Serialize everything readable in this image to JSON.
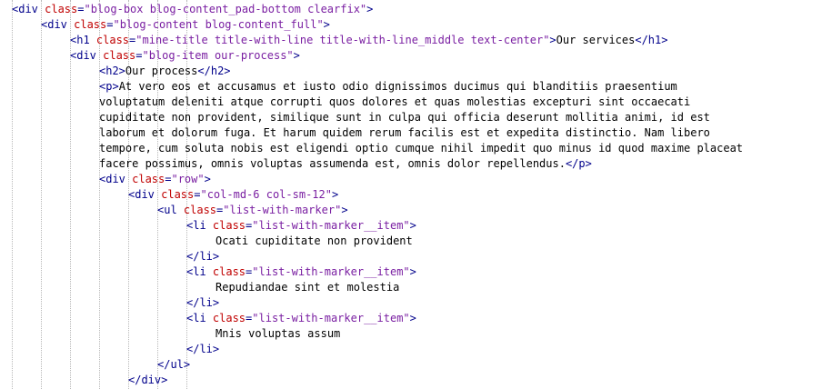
{
  "colors": {
    "background": "#ffffff",
    "tag": "#00008b",
    "attribute": "#c00000",
    "value": "#7a1fa2",
    "text": "#000000",
    "indent_guide": "#b8b8b8"
  },
  "lines": [
    {
      "indent": 0,
      "tokens": [
        {
          "t": "tag",
          "v": "<div "
        },
        {
          "t": "attr",
          "v": "class"
        },
        {
          "t": "tag",
          "v": "="
        },
        {
          "t": "val",
          "v": "\"blog-box blog-content_pad-bottom clearfix\""
        },
        {
          "t": "tag",
          "v": ">"
        }
      ]
    },
    {
      "indent": 1,
      "tokens": [
        {
          "t": "tag",
          "v": "<div "
        },
        {
          "t": "attr",
          "v": "class"
        },
        {
          "t": "tag",
          "v": "="
        },
        {
          "t": "val",
          "v": "\"blog-content blog-content_full\""
        },
        {
          "t": "tag",
          "v": ">"
        }
      ]
    },
    {
      "indent": 2,
      "tokens": [
        {
          "t": "tag",
          "v": "<h1 "
        },
        {
          "t": "attr",
          "v": "class"
        },
        {
          "t": "tag",
          "v": "="
        },
        {
          "t": "val",
          "v": "\"mine-title title-with-line title-with-line_middle text-center\""
        },
        {
          "t": "tag",
          "v": ">"
        },
        {
          "t": "txt",
          "v": "Our services"
        },
        {
          "t": "tag",
          "v": "</h1>"
        }
      ]
    },
    {
      "indent": 2,
      "tokens": [
        {
          "t": "tag",
          "v": "<div "
        },
        {
          "t": "attr",
          "v": "class"
        },
        {
          "t": "tag",
          "v": "="
        },
        {
          "t": "val",
          "v": "\"blog-item our-process\""
        },
        {
          "t": "tag",
          "v": ">"
        }
      ]
    },
    {
      "indent": 3,
      "tokens": [
        {
          "t": "tag",
          "v": "<h2>"
        },
        {
          "t": "txt",
          "v": "Our process"
        },
        {
          "t": "tag",
          "v": "</h2>"
        }
      ]
    },
    {
      "indent": 3,
      "tokens": [
        {
          "t": "tag",
          "v": "<p>"
        },
        {
          "t": "txt",
          "v": "At vero eos et accusamus et iusto odio dignissimos ducimus qui blanditiis praesentium"
        }
      ]
    },
    {
      "indent": 3,
      "tokens": [
        {
          "t": "txt",
          "v": "voluptatum deleniti atque corrupti quos dolores et quas molestias excepturi sint occaecati"
        }
      ]
    },
    {
      "indent": 3,
      "tokens": [
        {
          "t": "txt",
          "v": "cupiditate non provident, similique sunt in culpa qui officia deserunt mollitia animi, id est"
        }
      ]
    },
    {
      "indent": 3,
      "tokens": [
        {
          "t": "txt",
          "v": "laborum et dolorum fuga. Et harum quidem rerum facilis est et expedita distinctio. Nam libero"
        }
      ]
    },
    {
      "indent": 3,
      "tokens": [
        {
          "t": "txt",
          "v": "tempore, cum soluta nobis est eligendi optio cumque nihil impedit quo minus id quod maxime placeat"
        }
      ]
    },
    {
      "indent": 3,
      "tokens": [
        {
          "t": "txt",
          "v": "facere possimus, omnis voluptas assumenda est, omnis dolor repellendus."
        },
        {
          "t": "tag",
          "v": "</p>"
        }
      ]
    },
    {
      "indent": 3,
      "tokens": [
        {
          "t": "tag",
          "v": "<div "
        },
        {
          "t": "attr",
          "v": "class"
        },
        {
          "t": "tag",
          "v": "="
        },
        {
          "t": "val",
          "v": "\"row\""
        },
        {
          "t": "tag",
          "v": ">"
        }
      ]
    },
    {
      "indent": 4,
      "tokens": [
        {
          "t": "tag",
          "v": "<div "
        },
        {
          "t": "attr",
          "v": "class"
        },
        {
          "t": "tag",
          "v": "="
        },
        {
          "t": "val",
          "v": "\"col-md-6 col-sm-12\""
        },
        {
          "t": "tag",
          "v": ">"
        }
      ]
    },
    {
      "indent": 5,
      "tokens": [
        {
          "t": "tag",
          "v": "<ul "
        },
        {
          "t": "attr",
          "v": "class"
        },
        {
          "t": "tag",
          "v": "="
        },
        {
          "t": "val",
          "v": "\"list-with-marker\""
        },
        {
          "t": "tag",
          "v": ">"
        }
      ]
    },
    {
      "indent": 6,
      "tokens": [
        {
          "t": "tag",
          "v": "<li "
        },
        {
          "t": "attr",
          "v": "class"
        },
        {
          "t": "tag",
          "v": "="
        },
        {
          "t": "val",
          "v": "\"list-with-marker__item\""
        },
        {
          "t": "tag",
          "v": ">"
        }
      ]
    },
    {
      "indent": 7,
      "tokens": [
        {
          "t": "txt",
          "v": "Ocati cupiditate non provident"
        }
      ]
    },
    {
      "indent": 6,
      "tokens": [
        {
          "t": "tag",
          "v": "</li>"
        }
      ]
    },
    {
      "indent": 6,
      "tokens": [
        {
          "t": "tag",
          "v": "<li "
        },
        {
          "t": "attr",
          "v": "class"
        },
        {
          "t": "tag",
          "v": "="
        },
        {
          "t": "val",
          "v": "\"list-with-marker__item\""
        },
        {
          "t": "tag",
          "v": ">"
        }
      ]
    },
    {
      "indent": 7,
      "tokens": [
        {
          "t": "txt",
          "v": "Repudiandae sint et molestia"
        }
      ]
    },
    {
      "indent": 6,
      "tokens": [
        {
          "t": "tag",
          "v": "</li>"
        }
      ]
    },
    {
      "indent": 6,
      "tokens": [
        {
          "t": "tag",
          "v": "<li "
        },
        {
          "t": "attr",
          "v": "class"
        },
        {
          "t": "tag",
          "v": "="
        },
        {
          "t": "val",
          "v": "\"list-with-marker__item\""
        },
        {
          "t": "tag",
          "v": ">"
        }
      ]
    },
    {
      "indent": 7,
      "tokens": [
        {
          "t": "txt",
          "v": "Mnis voluptas assum"
        }
      ]
    },
    {
      "indent": 6,
      "tokens": [
        {
          "t": "tag",
          "v": "</li>"
        }
      ]
    },
    {
      "indent": 5,
      "tokens": [
        {
          "t": "tag",
          "v": "</ul>"
        }
      ]
    },
    {
      "indent": 4,
      "tokens": [
        {
          "t": "tag",
          "v": "</div>"
        }
      ]
    }
  ]
}
